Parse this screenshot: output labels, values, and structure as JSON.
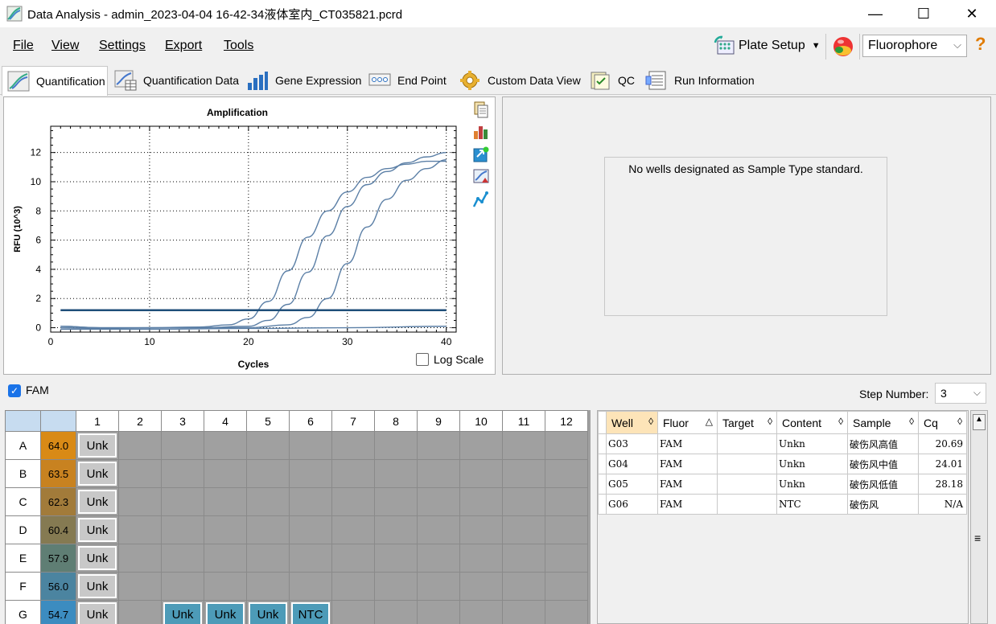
{
  "window": {
    "title": "Data Analysis - admin_2023-04-04 16-42-34液体室内_CT035821.pcrd",
    "minimize": "—",
    "maximize": "☐",
    "close": "✕"
  },
  "menu": {
    "file": "File",
    "view": "View",
    "settings": "Settings",
    "export": "Export",
    "tools": "Tools",
    "plate_setup": "Plate Setup",
    "fluorophore": "Fluorophore",
    "help": "?"
  },
  "tabs": [
    {
      "label": "Quantification"
    },
    {
      "label": "Quantification Data"
    },
    {
      "label": "Gene Expression"
    },
    {
      "label": "End Point"
    },
    {
      "label": "Custom Data View"
    },
    {
      "label": "QC"
    },
    {
      "label": "Run Information"
    }
  ],
  "chart": {
    "log_scale_label": "Log Scale"
  },
  "chart_data": {
    "type": "line",
    "title": "Amplification",
    "xlabel": "Cycles",
    "ylabel": "RFU (10^3)",
    "xlim": [
      0,
      41
    ],
    "ylim": [
      -0.3,
      13.8
    ],
    "xticks": [
      0,
      10,
      20,
      30,
      40
    ],
    "yticks": [
      0,
      2,
      4,
      6,
      8,
      10,
      12
    ],
    "grid": true,
    "threshold": 1.2,
    "series": [
      {
        "x": [
          1,
          5,
          10,
          15,
          18,
          20,
          22,
          24,
          26,
          28,
          30,
          32,
          34,
          36,
          38,
          40
        ],
        "y": [
          0.1,
          0.0,
          0.0,
          0.05,
          0.2,
          0.6,
          1.8,
          3.9,
          6.2,
          8.0,
          9.3,
          10.3,
          10.9,
          11.2,
          11.4,
          11.4
        ]
      },
      {
        "x": [
          1,
          5,
          10,
          15,
          20,
          22,
          24,
          26,
          28,
          30,
          32,
          34,
          36,
          38,
          40
        ],
        "y": [
          0.1,
          0.0,
          0.0,
          0.0,
          0.1,
          0.5,
          1.6,
          3.8,
          6.3,
          8.3,
          9.8,
          10.7,
          11.3,
          11.7,
          12.0
        ]
      },
      {
        "x": [
          1,
          5,
          10,
          15,
          20,
          24,
          26,
          28,
          30,
          32,
          34,
          36,
          38,
          40
        ],
        "y": [
          0.0,
          -0.05,
          0.0,
          0.0,
          0.0,
          0.2,
          0.7,
          2.0,
          4.4,
          6.9,
          8.8,
          10.1,
          10.9,
          11.5
        ]
      },
      {
        "x": [
          1,
          10,
          20,
          30,
          40
        ],
        "y": [
          -0.1,
          -0.1,
          -0.05,
          0.0,
          0.1
        ]
      }
    ]
  },
  "standard_panel": {
    "message": "No wells designated as Sample Type standard."
  },
  "fam": {
    "label": "FAM",
    "checked": "✓"
  },
  "step": {
    "label": "Step Number:",
    "value": "3"
  },
  "plate": {
    "columns": [
      "1",
      "2",
      "3",
      "4",
      "5",
      "6",
      "7",
      "8",
      "9",
      "10",
      "11",
      "12"
    ],
    "rows": [
      {
        "label": "A",
        "temp": "64.0",
        "color": "#d98a16",
        "wells": [
          "Unk",
          "",
          "",
          "",
          "",
          "",
          "",
          "",
          "",
          "",
          "",
          ""
        ]
      },
      {
        "label": "B",
        "temp": "63.5",
        "color": "#c88220",
        "wells": [
          "Unk",
          "",
          "",
          "",
          "",
          "",
          "",
          "",
          "",
          "",
          "",
          ""
        ]
      },
      {
        "label": "C",
        "temp": "62.3",
        "color": "#a27b3a",
        "wells": [
          "Unk",
          "",
          "",
          "",
          "",
          "",
          "",
          "",
          "",
          "",
          "",
          ""
        ]
      },
      {
        "label": "D",
        "temp": "60.4",
        "color": "#857a52",
        "wells": [
          "Unk",
          "",
          "",
          "",
          "",
          "",
          "",
          "",
          "",
          "",
          "",
          ""
        ]
      },
      {
        "label": "E",
        "temp": "57.9",
        "color": "#5f7e74",
        "wells": [
          "Unk",
          "",
          "",
          "",
          "",
          "",
          "",
          "",
          "",
          "",
          "",
          ""
        ]
      },
      {
        "label": "F",
        "temp": "56.0",
        "color": "#4b84a0",
        "wells": [
          "Unk",
          "",
          "",
          "",
          "",
          "",
          "",
          "",
          "",
          "",
          "",
          ""
        ]
      },
      {
        "label": "G",
        "temp": "54.7",
        "color": "#3c8cc0",
        "wells": [
          "Unk",
          "",
          "Unk",
          "Unk",
          "Unk",
          "NTC",
          "",
          "",
          "",
          "",
          "",
          ""
        ]
      }
    ]
  },
  "results": {
    "headers": [
      {
        "label": "Well",
        "sort": "◊"
      },
      {
        "label": "Fluor",
        "sort": "△"
      },
      {
        "label": "Target",
        "sort": "◊"
      },
      {
        "label": "Content",
        "sort": "◊"
      },
      {
        "label": "Sample",
        "sort": "◊"
      },
      {
        "label": "Cq",
        "sort": "◊"
      }
    ],
    "rows": [
      [
        "G03",
        "FAM",
        "",
        "Unkn",
        "破伤风高值",
        "20.69"
      ],
      [
        "G04",
        "FAM",
        "",
        "Unkn",
        "破伤风中值",
        "24.01"
      ],
      [
        "G05",
        "FAM",
        "",
        "Unkn",
        "破伤风低值",
        "28.18"
      ],
      [
        "G06",
        "FAM",
        "",
        "NTC",
        "破伤风",
        "N/A"
      ]
    ]
  }
}
